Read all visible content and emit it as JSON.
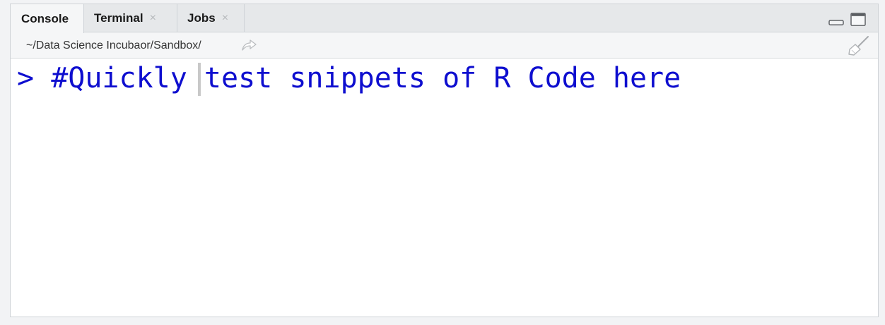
{
  "tabs": [
    {
      "label": "Console",
      "closable": false,
      "active": true
    },
    {
      "label": "Terminal",
      "closable": true,
      "active": false
    },
    {
      "label": "Jobs",
      "closable": true,
      "active": false
    }
  ],
  "tab_close_glyph": "×",
  "path_bar": {
    "path": "~/Data Science Incubaor/Sandbox/"
  },
  "console": {
    "prompt": ">",
    "input": "#Quickly test snippets of R Code here"
  },
  "colors": {
    "console_text": "#0e0ecf",
    "pane_border": "#cfd3d7",
    "tab_bar": "#e6e8ea"
  },
  "icons": [
    "minimize-icon",
    "maximize-icon",
    "goto-directory-icon",
    "clear-console-broom-icon",
    "close-icon"
  ]
}
